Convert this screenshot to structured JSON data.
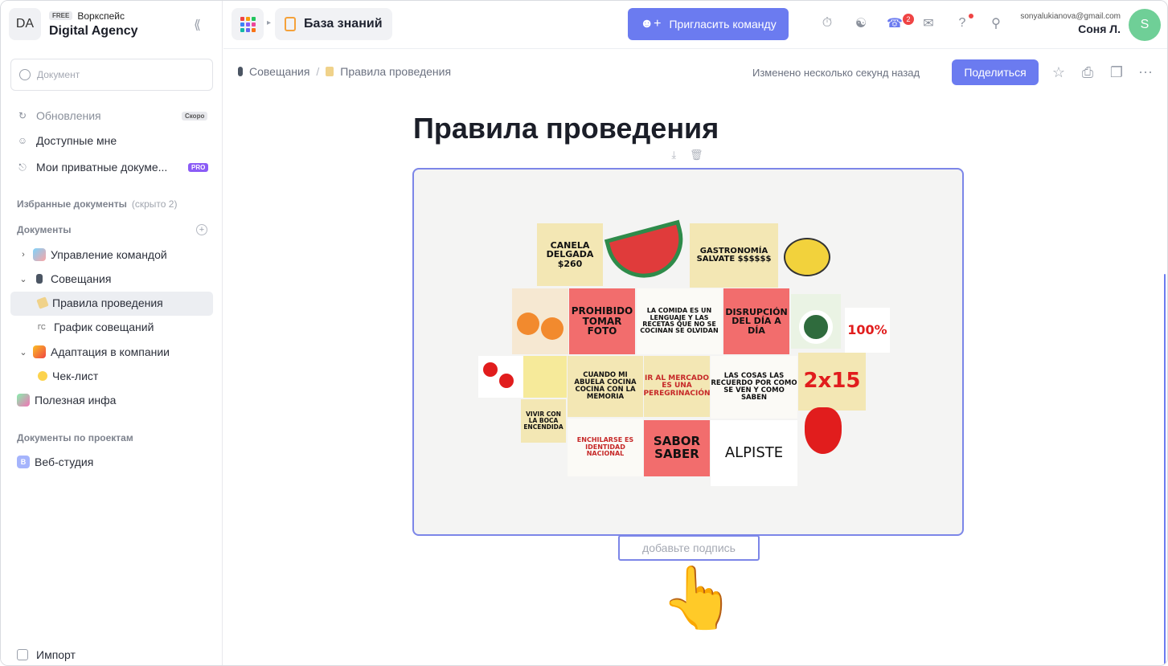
{
  "workspace": {
    "initials": "DA",
    "plan": "FREE",
    "label": "Воркспейс",
    "name": "Digital Agency"
  },
  "sidebar": {
    "search_placeholder": "Документ",
    "items": [
      {
        "label": "Обновления",
        "badge": "Скоро"
      },
      {
        "label": "Доступные мне"
      },
      {
        "label": "Мои приватные докуме...",
        "badge": "PRO"
      }
    ],
    "favorites": {
      "label": "Избранные документы",
      "hint": "(скрыто 2)"
    },
    "documents_label": "Документы",
    "tree": [
      {
        "label": "Управление командой"
      },
      {
        "label": "Совещания"
      },
      {
        "label": "Правила проведения"
      },
      {
        "label": "График совещаний",
        "icon_text": "ГС"
      },
      {
        "label": "Адаптация в компании"
      },
      {
        "label": "Чек-лист"
      },
      {
        "label": "Полезная инфа"
      }
    ],
    "projects_label": "Документы по проектам",
    "projects": [
      {
        "label": "Веб-студия",
        "badge": "В"
      }
    ],
    "import_label": "Импорт"
  },
  "topbar": {
    "section_title": "База знаний",
    "invite_label": "Пригласить команду",
    "notifications_count": "2",
    "user_email": "sonyalukianova@gmail.com",
    "user_name": "Соня Л.",
    "user_initial": "S"
  },
  "doc": {
    "breadcrumb": [
      "Совещания",
      "Правила проведения"
    ],
    "changed": "Изменено несколько секунд назад",
    "share_label": "Поделиться",
    "title": "Правила проведения",
    "caption_placeholder": "добавьте подпись",
    "pointer_emoji": "👆"
  },
  "artwork": {
    "tiles": [
      {
        "text": "CANELA DELGADA $260"
      },
      {
        "text": "GASTRONOMÍA SALVATE $$$$$$"
      },
      {
        "text": "PROHIBIDO TOMAR FOTO"
      },
      {
        "text": "LA COMIDA ES UN LENGUAJE Y LAS RECETAS QUE NO SE COCINAN SE OLVIDAN"
      },
      {
        "text": "DISRUPCIÓN DEL DÍA A DÍA"
      },
      {
        "text": "100%"
      },
      {
        "text": "CUANDO MI ABUELA COCINA COCINA CON LA MEMORIA"
      },
      {
        "text": "IR AL MERCADO ES UNA PEREGRINACIÓN"
      },
      {
        "text": "LAS COSAS LAS RECUERDO POR COMO SE VEN Y COMO SABEN"
      },
      {
        "text": "2x15"
      },
      {
        "text": "VIVIR CON LA BOCA ENCENDIDA"
      },
      {
        "text": "ENCHILARSE ES IDENTIDAD NACIONAL"
      },
      {
        "text": "SABOR SABER"
      },
      {
        "text": "ALPISTE"
      }
    ]
  }
}
